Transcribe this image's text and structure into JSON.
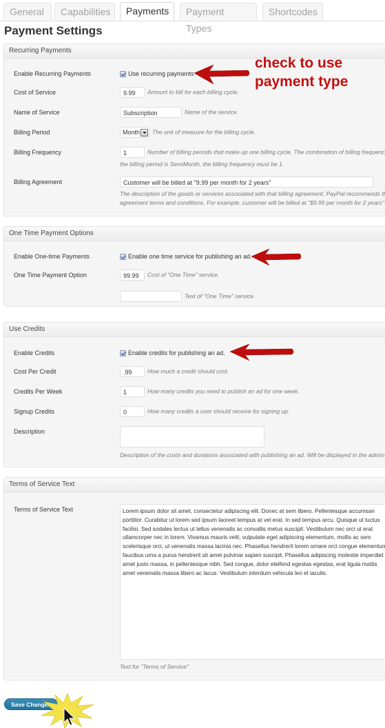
{
  "tabs": [
    {
      "label": "General",
      "active": false
    },
    {
      "label": "Capabilities",
      "active": false
    },
    {
      "label": "Payments",
      "active": true
    },
    {
      "label": "Payment Types",
      "active": false
    },
    {
      "label": "Shortcodes",
      "active": false
    }
  ],
  "page_title": "Payment Settings",
  "recurring": {
    "title": "Recurring Payments",
    "enable": {
      "label": "Enable Recurring Payments",
      "checkbox_label": "Use recurring payments",
      "checked": true
    },
    "cost": {
      "label": "Cost of Service",
      "value": "9.99",
      "description": "Amount to bill for each billing cycle."
    },
    "name": {
      "label": "Name of Service",
      "value": "Subscription",
      "description": "Name of the service."
    },
    "period": {
      "label": "Billing Period",
      "value": "Month",
      "description": "The unit of measure for the billing cycle."
    },
    "frequency": {
      "label": "Billing Frequency",
      "value": "1",
      "description_line1": "Number of billing periods that make up one billing cycle. The combination of billing frequency",
      "description_line2": "the billing period is SemiMonth, the billing frequency must be 1."
    },
    "agreement": {
      "label": "Billing Agreement",
      "value": "Customer will be billed at \"9.99 per month for 2 years\"",
      "description_line1": "The description of the goods or services associated with that billing agreement. PayPal recommends that",
      "description_line2": "agreement terms and conditions. For example, customer will be billed at \"$9.99 per month for 2 years\""
    }
  },
  "one_time": {
    "title": "One Time Payment Options",
    "enable": {
      "label": "Enable One-time Payments",
      "checkbox_label": "Enable one time service for publishing an ad.",
      "checked": true
    },
    "option": {
      "label": "One Time Payment Option",
      "value": "99.99",
      "description": "Cost of \"One Time\" service."
    },
    "text": {
      "value": "",
      "description": "Text of \"One Time\" service."
    }
  },
  "credits": {
    "title": "Use Credits",
    "enable": {
      "label": "Enable Credits",
      "checkbox_label": "Enable credits for publishing an ad.",
      "checked": true
    },
    "cost": {
      "label": "Cost Per Credit",
      "value": ".99",
      "description": "How much a credit should cost."
    },
    "per_week": {
      "label": "Credits Per Week",
      "value": "1",
      "description": "How many credits you need to publish an ad for one week."
    },
    "signup": {
      "label": "Signup Credits",
      "value": "0",
      "description": "How many credits a user should receive for signing up."
    },
    "description": {
      "label": "Description",
      "value": "",
      "description": "Description of the costs and durations associated with publishing an ad. Will be displayed in the admin"
    }
  },
  "tos": {
    "title": "Terms of Service Text",
    "label": "Terms of Service Text",
    "lines": [
      "Lorem ipsum dolor sit amet, consectetur adipiscing elit. Donec at sem libero. Pellentesque accumsan",
      "porttitor. Curabitur ut lorem sed ipsum laoreet tempus at vel erat. In sed tempus arcu. Quisque ut luctus",
      "facilisi. Sed sodales lectus ut tellus venenatis ac convallis metus suscipit. Vestibulum nec orci ut erat",
      "ullamcorper nec in lorem. Vivamus mauris velit, vulputate eget adipiscing elementum, mollis ac sem",
      "scelerisque orci, ut venenatis massa lacinia nec. Phasellus hendrerit lorem ornare orci congue elementum",
      "faucibus urna a purus hendrerit sit amet pulvinar sapien suscipit. Phasellus adipiscing molestie imperdiet",
      "amet justo massa, in pellentesque nibh. Sed congue, dolor eleifend egestas egestas, erat ligula mattis",
      "amet venenatis massa libero ac lacus. Vestibulum interdum vehicula leo et iaculis."
    ],
    "description": "Text for \"Terms of Service\""
  },
  "annotation": {
    "line1": "check to use",
    "line2": "payment type",
    "color": "#c30f0f"
  },
  "save_button": "Save Changes"
}
